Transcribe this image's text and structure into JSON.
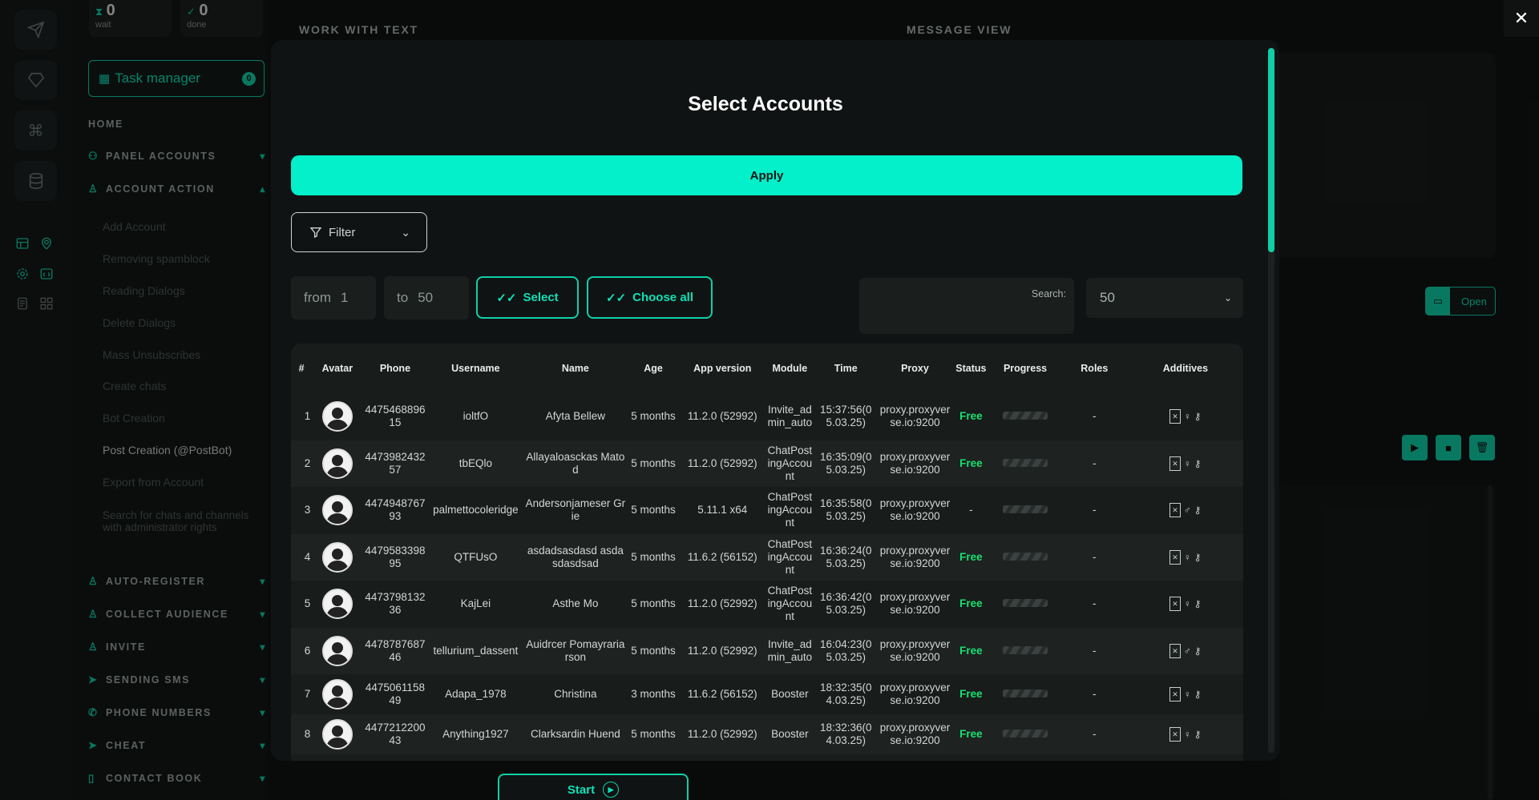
{
  "stats": [
    {
      "icon": "hourglass-icon",
      "value": "0",
      "label": "wait"
    },
    {
      "icon": "check-circle-icon",
      "value": "0",
      "label": "done"
    }
  ],
  "task_manager": {
    "label": "Task manager",
    "badge": "0"
  },
  "nav": {
    "home": "HOME",
    "panel_accounts": "PANEL ACCOUNTS",
    "account_action": "ACCOUNT ACTION",
    "account_action_items": [
      "Add Account",
      "Removing spamblock",
      "Reading Dialogs",
      "Delete Dialogs",
      "Mass Unsubscribes",
      "Create chats",
      "Bot Creation",
      "Post Creation (@PostBot)",
      "Export from Account",
      "Search for chats and channels with administrator rights"
    ],
    "auto_register": "AUTO-REGISTER",
    "collect_audience": "COLLECT AUDIENCE",
    "invite": "INVITE",
    "sending_sms": "SENDING SMS",
    "phone_numbers": "PHONE NUMBERS",
    "cheat": "CHEAT",
    "contact_book": "CONTACT BOOK"
  },
  "background": {
    "work_with_text": "WORK WITH TEXT",
    "message_view": "MESSAGE VIEW",
    "open_label": "Open"
  },
  "modal": {
    "title": "Select Accounts",
    "apply": "Apply",
    "filter": "Filter",
    "from_label": "from",
    "from_value": "1",
    "to_label": "to",
    "to_value": "50",
    "select": "Select",
    "choose_all": "Choose all",
    "search_label": "Search:",
    "page_size": "50",
    "start": "Start"
  },
  "table": {
    "headers": [
      "#",
      "Avatar",
      "Phone",
      "Username",
      "Name",
      "Age",
      "App version",
      "Module",
      "Time",
      "Proxy",
      "Status",
      "Progress",
      "Roles",
      "Additives"
    ],
    "rows": [
      {
        "n": "1",
        "phone": "447546889615",
        "username": "ioltfO",
        "name": "Afyta Bellew",
        "age": "5 months",
        "app": "11.2.0 (52992)",
        "module": "Invite_admin_auto",
        "time": "15:37:56(05.03.25)",
        "proxy": "proxy.proxyverse.io:9200",
        "status": "Free",
        "roles": "-",
        "gender": "female"
      },
      {
        "n": "2",
        "phone": "447398243257",
        "username": "tbEQlo",
        "name": "Allayaloasckas Matod",
        "age": "5 months",
        "app": "11.2.0 (52992)",
        "module": "ChatPostingAccount",
        "time": "16:35:09(05.03.25)",
        "proxy": "proxy.proxyverse.io:9200",
        "status": "Free",
        "roles": "-",
        "gender": "female"
      },
      {
        "n": "3",
        "phone": "447494876793",
        "username": "palmettocoleridge",
        "name": "Andersonjameser Grie",
        "age": "5 months",
        "app": "5.11.1 x64",
        "module": "ChatPostingAccount",
        "time": "16:35:58(05.03.25)",
        "proxy": "proxy.proxyverse.io:9200",
        "status": "-",
        "roles": "-",
        "gender": "male"
      },
      {
        "n": "4",
        "phone": "447958339895",
        "username": "QTFUsO",
        "name": "asdadsasdasd asdasdasdsad",
        "age": "5 months",
        "app": "11.6.2 (56152)",
        "module": "ChatPostingAccount",
        "time": "16:36:24(05.03.25)",
        "proxy": "proxy.proxyverse.io:9200",
        "status": "Free",
        "roles": "-",
        "gender": "female"
      },
      {
        "n": "5",
        "phone": "447379813236",
        "username": "KajLei",
        "name": "Asthe Mo",
        "age": "5 months",
        "app": "11.2.0 (52992)",
        "module": "ChatPostingAccount",
        "time": "16:36:42(05.03.25)",
        "proxy": "proxy.proxyverse.io:9200",
        "status": "Free",
        "roles": "-",
        "gender": "female"
      },
      {
        "n": "6",
        "phone": "447878768746",
        "username": "tellurium_dassent",
        "name": "Auidrcer Pomayrariarson",
        "age": "5 months",
        "app": "11.2.0 (52992)",
        "module": "Invite_admin_auto",
        "time": "16:04:23(05.03.25)",
        "proxy": "proxy.proxyverse.io:9200",
        "status": "Free",
        "roles": "-",
        "gender": "male"
      },
      {
        "n": "7",
        "phone": "447506115849",
        "username": "Adapa_1978",
        "name": "Christina",
        "age": "3 months",
        "app": "11.6.2 (56152)",
        "module": "Booster",
        "time": "18:32:35(04.03.25)",
        "proxy": "proxy.proxyverse.io:9200",
        "status": "Free",
        "roles": "-",
        "gender": "female"
      },
      {
        "n": "8",
        "phone": "447721220043",
        "username": "Anything1927",
        "name": "Clarksardin Huend",
        "age": "5 months",
        "app": "11.2.0 (52992)",
        "module": "Booster",
        "time": "18:32:36(04.03.25)",
        "proxy": "proxy.proxyverse.io:9200",
        "status": "Free",
        "roles": "-",
        "gender": "female"
      }
    ]
  },
  "colors": {
    "accent": "#03f0cb",
    "free_status": "#18e070",
    "background": "#111313"
  }
}
